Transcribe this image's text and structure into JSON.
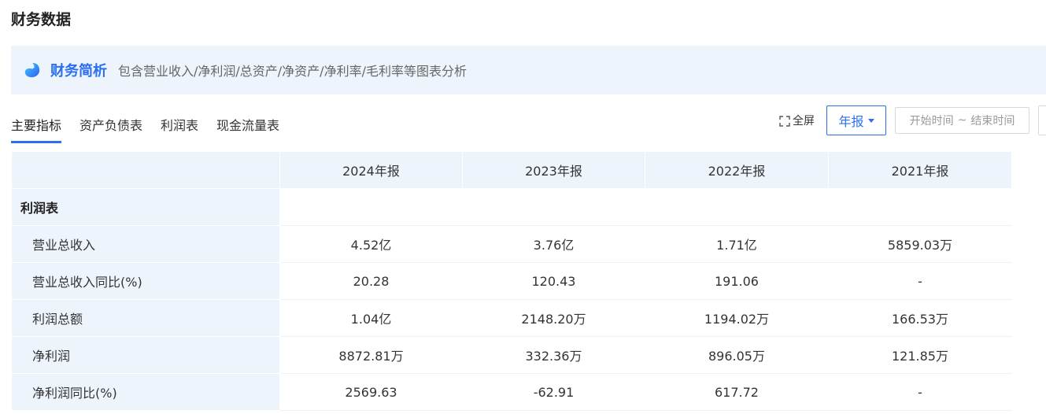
{
  "page": {
    "title": "财务数据"
  },
  "banner": {
    "icon": "finance-logo-icon",
    "name": "财务简析",
    "description": "包含营业收入/净利润/总资产/净资产/净利率/毛利率等图表分析"
  },
  "tabs": [
    {
      "label": "主要指标",
      "active": true
    },
    {
      "label": "资产负债表",
      "active": false
    },
    {
      "label": "利润表",
      "active": false
    },
    {
      "label": "现金流量表",
      "active": false
    }
  ],
  "toolbar": {
    "fullscreen_label": "全屏",
    "fullscreen_icon": "expand-icon",
    "period_label": "年报",
    "date_start_placeholder": "开始时间",
    "date_separator": "~",
    "date_end_placeholder": "结束时间"
  },
  "table": {
    "columns": [
      "2024年报",
      "2023年报",
      "2022年报",
      "2021年报"
    ],
    "section_title": "利润表",
    "rows": [
      {
        "label": "营业总收入",
        "values": [
          "4.52亿",
          "3.76亿",
          "1.71亿",
          "5859.03万"
        ]
      },
      {
        "label": "营业总收入同比(%)",
        "values": [
          "20.28",
          "120.43",
          "191.06",
          "-"
        ]
      },
      {
        "label": "利润总额",
        "values": [
          "1.04亿",
          "2148.20万",
          "1194.02万",
          "166.53万"
        ]
      },
      {
        "label": "净利润",
        "values": [
          "8872.81万",
          "332.36万",
          "896.05万",
          "121.85万"
        ]
      },
      {
        "label": "净利润同比(%)",
        "values": [
          "2569.63",
          "-62.91",
          "617.72",
          "-"
        ]
      }
    ]
  },
  "colors": {
    "accent": "#2b6ff0",
    "header_bg": "#eef4fc",
    "text": "#333333"
  }
}
